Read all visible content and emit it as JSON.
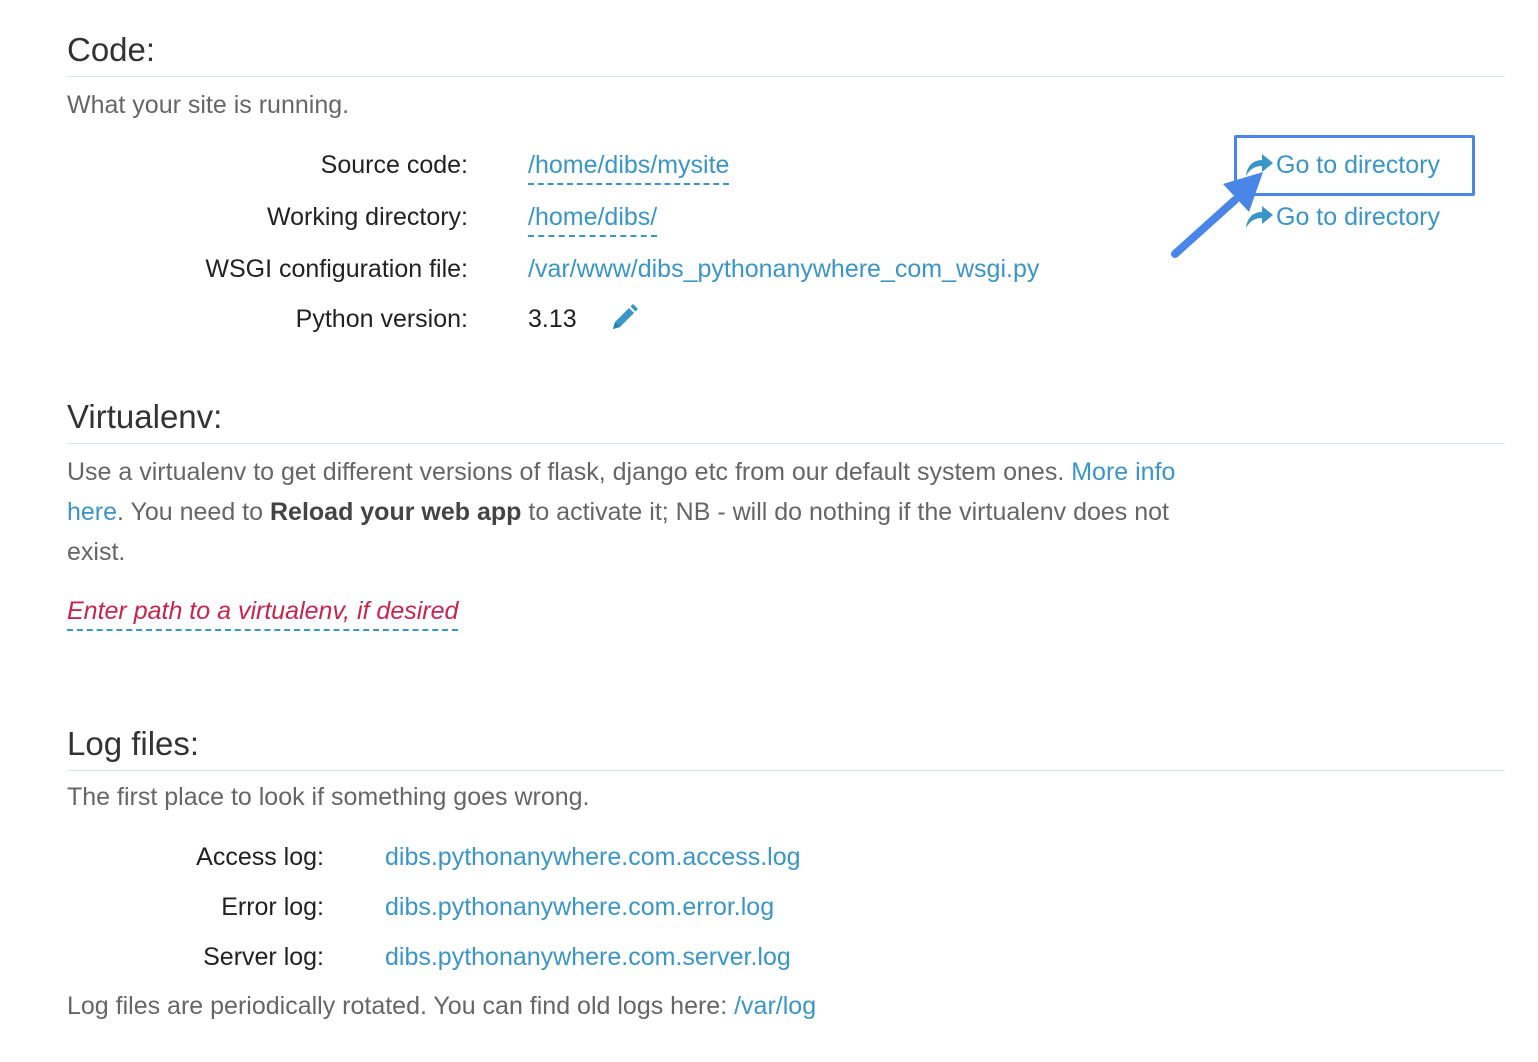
{
  "code": {
    "title": "Code:",
    "description": "What your site is running.",
    "rows": [
      {
        "label": "Source code:",
        "value": "/home/dibs/mysite",
        "action": "Go to directory"
      },
      {
        "label": "Working directory:",
        "value": "/home/dibs/",
        "action": "Go to directory"
      },
      {
        "label": "WSGI configuration file:",
        "value": "/var/www/dibs_pythonanywhere_com_wsgi.py"
      },
      {
        "label": "Python version:",
        "value": "3.13"
      }
    ]
  },
  "virtualenv": {
    "title": "Virtualenv:",
    "text_before_link": "Use a virtualenv to get different versions of flask, django etc from our default system ones. ",
    "link": "More info here",
    "text_after_link": ". You need to ",
    "bold": "Reload your web app",
    "text_end": " to activate it; NB - will do nothing if the virtualenv does not exist.",
    "placeholder": "Enter path to a virtualenv, if desired"
  },
  "logs": {
    "title": "Log files:",
    "description": "The first place to look if something goes wrong.",
    "rows": [
      {
        "label": "Access log:",
        "value": "dibs.pythonanywhere.com.access.log"
      },
      {
        "label": "Error log:",
        "value": "dibs.pythonanywhere.com.error.log"
      },
      {
        "label": "Server log:",
        "value": "dibs.pythonanywhere.com.server.log"
      }
    ],
    "footer_text": "Log files are periodically rotated. You can find old logs here: ",
    "footer_link": "/var/log"
  },
  "colors": {
    "link": "#3a95c9",
    "highlight": "#4a86e8",
    "placeholder": "#c7254e"
  },
  "icons": {
    "go_to_directory": "share-arrow-icon",
    "edit": "pencil-icon",
    "annotation": "pointer-arrow-icon"
  }
}
